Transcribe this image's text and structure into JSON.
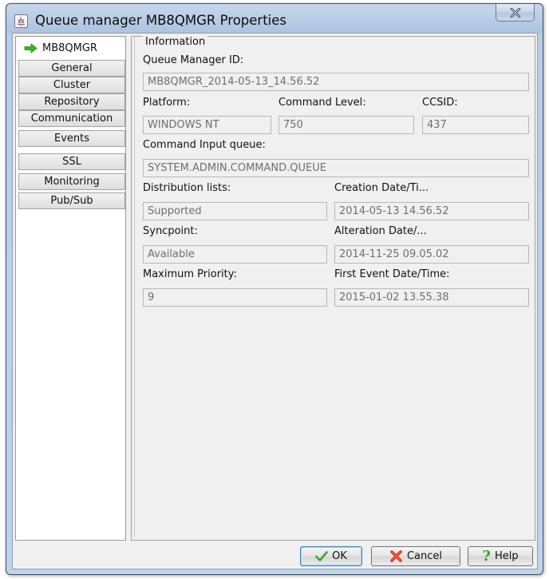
{
  "window": {
    "title": "Queue manager MB8QMGR Properties"
  },
  "nav": {
    "items": [
      {
        "label": "MB8QMGR",
        "selected": true
      },
      {
        "label": "General"
      },
      {
        "label": "Cluster"
      },
      {
        "label": "Repository"
      },
      {
        "label": "Communication"
      },
      {
        "label": "Events"
      },
      {
        "label": "SSL"
      },
      {
        "label": "Monitoring"
      },
      {
        "label": "Pub/Sub"
      }
    ]
  },
  "info": {
    "group_title": "Information",
    "qmgr_id_label": "Queue Manager ID:",
    "qmgr_id_value": "MB8QMGR_2014-05-13_14.56.52",
    "platform_label": "Platform:",
    "platform_value": "WINDOWS NT",
    "command_level_label": "Command Level:",
    "command_level_value": "750",
    "ccsid_label": "CCSID:",
    "ccsid_value": "437",
    "command_input_label": "Command Input queue:",
    "command_input_value": "SYSTEM.ADMIN.COMMAND.QUEUE",
    "dist_lists_label": "Distribution lists:",
    "dist_lists_value": "Supported",
    "creation_label": "Creation Date/Ti...",
    "creation_value": "2014-05-13 14.56.52",
    "syncpoint_label": "Syncpoint:",
    "syncpoint_value": "Available",
    "alteration_label": "Alteration Date/...",
    "alteration_value": "2014-11-25 09.05.02",
    "max_priority_label": "Maximum Priority:",
    "max_priority_value": "9",
    "first_event_label": "First Event Date/Time:",
    "first_event_value": "2015-01-02 13.55.38"
  },
  "buttons": {
    "ok": "OK",
    "cancel": "Cancel",
    "help": "Help"
  },
  "icons": {
    "title": "java-icon",
    "close": "close-icon",
    "nav_selected": "green-arrow-icon",
    "ok": "checkmark-icon",
    "cancel": "red-x-icon",
    "help": "question-mark-icon"
  },
  "colors": {
    "arrow_green": "#3cb521",
    "check_green": "#3aa33a",
    "cancel_red": "#d9281c",
    "help_green": "#3a9d2a"
  }
}
